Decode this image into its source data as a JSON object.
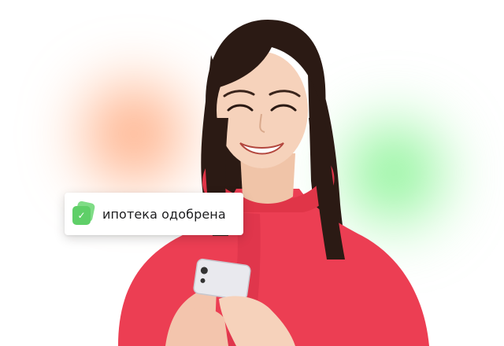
{
  "toast": {
    "text": "ипотека одобрена",
    "icon": "check-badge-icon"
  },
  "colors": {
    "glow_orange": "#ff7a3c",
    "glow_green": "#46eb5a",
    "hoodie": "#ec3e53",
    "icon_green": "#5fcf68",
    "background": "#ffffff"
  }
}
